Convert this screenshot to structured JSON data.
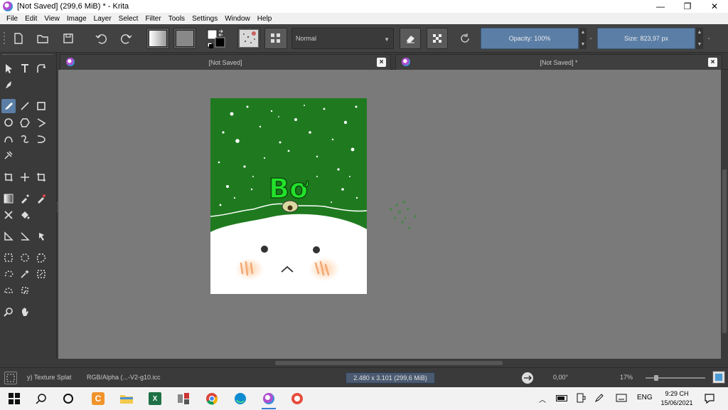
{
  "window": {
    "title": "[Not Saved]  (299,6 MiB)  * - Krita",
    "minimize": "—",
    "restore": "❐",
    "close": "✕"
  },
  "menu": [
    "File",
    "Edit",
    "View",
    "Image",
    "Layer",
    "Select",
    "Filter",
    "Tools",
    "Settings",
    "Window",
    "Help"
  ],
  "toolbar": {
    "blend_mode": "Normal",
    "opacity_label": "Opacity: 100%",
    "size_label": "Size: 823,97 px",
    "dash": "-"
  },
  "tabs": [
    {
      "label": "[Not Saved]"
    },
    {
      "label": "[Not Saved]  *"
    }
  ],
  "status": {
    "brush": "y) Texture Splat",
    "color_profile": "RGB/Alpha (...-V2-g10.icc",
    "dimensions": "2.480 x 3.101 (299,6 MiB)",
    "rotation": "0,00°",
    "zoom": "17%"
  },
  "taskbar": {
    "language": "ENG",
    "time": "9:29 CH",
    "date": "15/06/2021"
  },
  "artwork": {
    "text": "Bơ",
    "green": "#1f7a1f",
    "text_color": "#22e22a"
  },
  "colors": {
    "accent": "#5a7ea6",
    "canvas_bg": "#7a7a7a"
  }
}
